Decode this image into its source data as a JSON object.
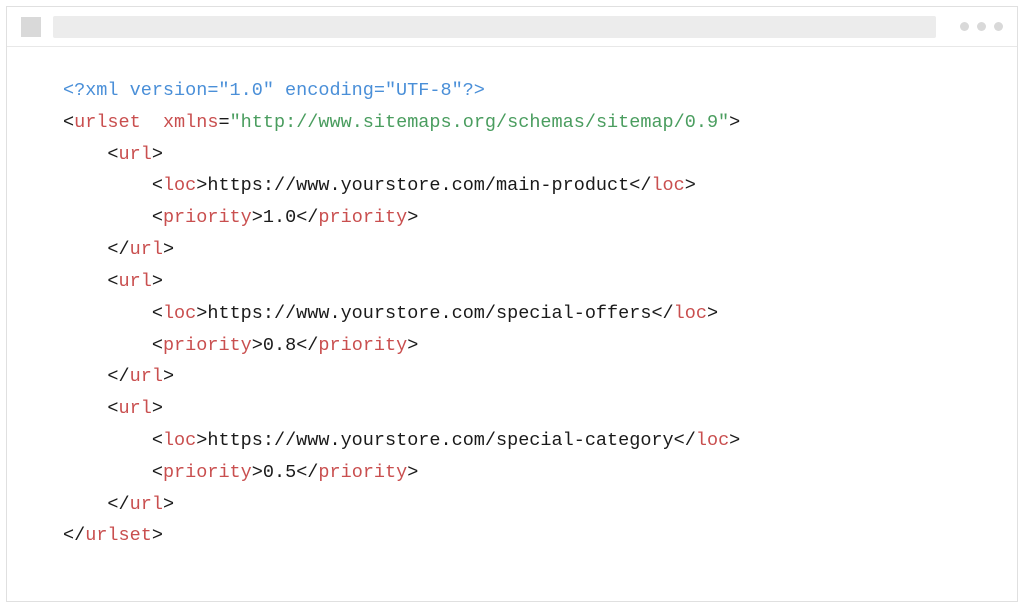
{
  "xml": {
    "declaration": "<?xml version=\"1.0\" encoding=\"UTF-8\"?>",
    "root_tag": "urlset",
    "xmlns_name": "xmlns",
    "xmlns_value": "\"http://www.sitemaps.org/schemas/sitemap/0.9\"",
    "url_tag": "url",
    "loc_tag": "loc",
    "priority_tag": "priority",
    "entries": [
      {
        "loc": "https://www.yourstore.com/main-product",
        "priority": "1.0"
      },
      {
        "loc": "https://www.yourstore.com/special-offers",
        "priority": "0.8"
      },
      {
        "loc": "https://www.yourstore.com/special-category",
        "priority": "0.5"
      }
    ]
  },
  "punct": {
    "lt": "<",
    "gt": ">",
    "lt_slash": "</",
    "eq": "="
  }
}
